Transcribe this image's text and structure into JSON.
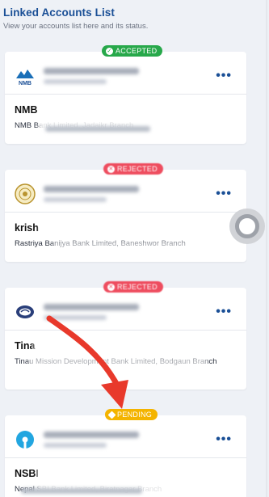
{
  "header": {
    "title": "Linked Accounts List",
    "subtitle": "View your accounts list here and its status."
  },
  "accounts": [
    {
      "status": "ACCEPTED",
      "logo_icon": "nmb-logo-icon",
      "bank_short": "NMB",
      "branch": "NMB Bank Limited, Jadajkr Branch",
      "more_label": "•••"
    },
    {
      "status": "REJECTED",
      "logo_icon": "rastriya-banijya-logo-icon",
      "bank_short": "krish",
      "branch": "Rastriya Banijya Bank Limited, Baneshwor Branch",
      "more_label": "•••"
    },
    {
      "status": "REJECTED",
      "logo_icon": "tinau-mission-logo-icon",
      "bank_short": "Tina",
      "branch": "Tinau Mission Development Bank Limited, Bodgaun Branch",
      "more_label": "•••"
    },
    {
      "status": "PENDING",
      "logo_icon": "sbi-logo-icon",
      "bank_short": "NSBI",
      "branch": "Nepal SBI Bank Limited, Biratnagar Branch",
      "more_label": "•••"
    }
  ],
  "colors": {
    "accent": "#1a4f96",
    "accepted": "#27a84a",
    "rejected": "#ee4d5f",
    "pending": "#f4b400"
  }
}
